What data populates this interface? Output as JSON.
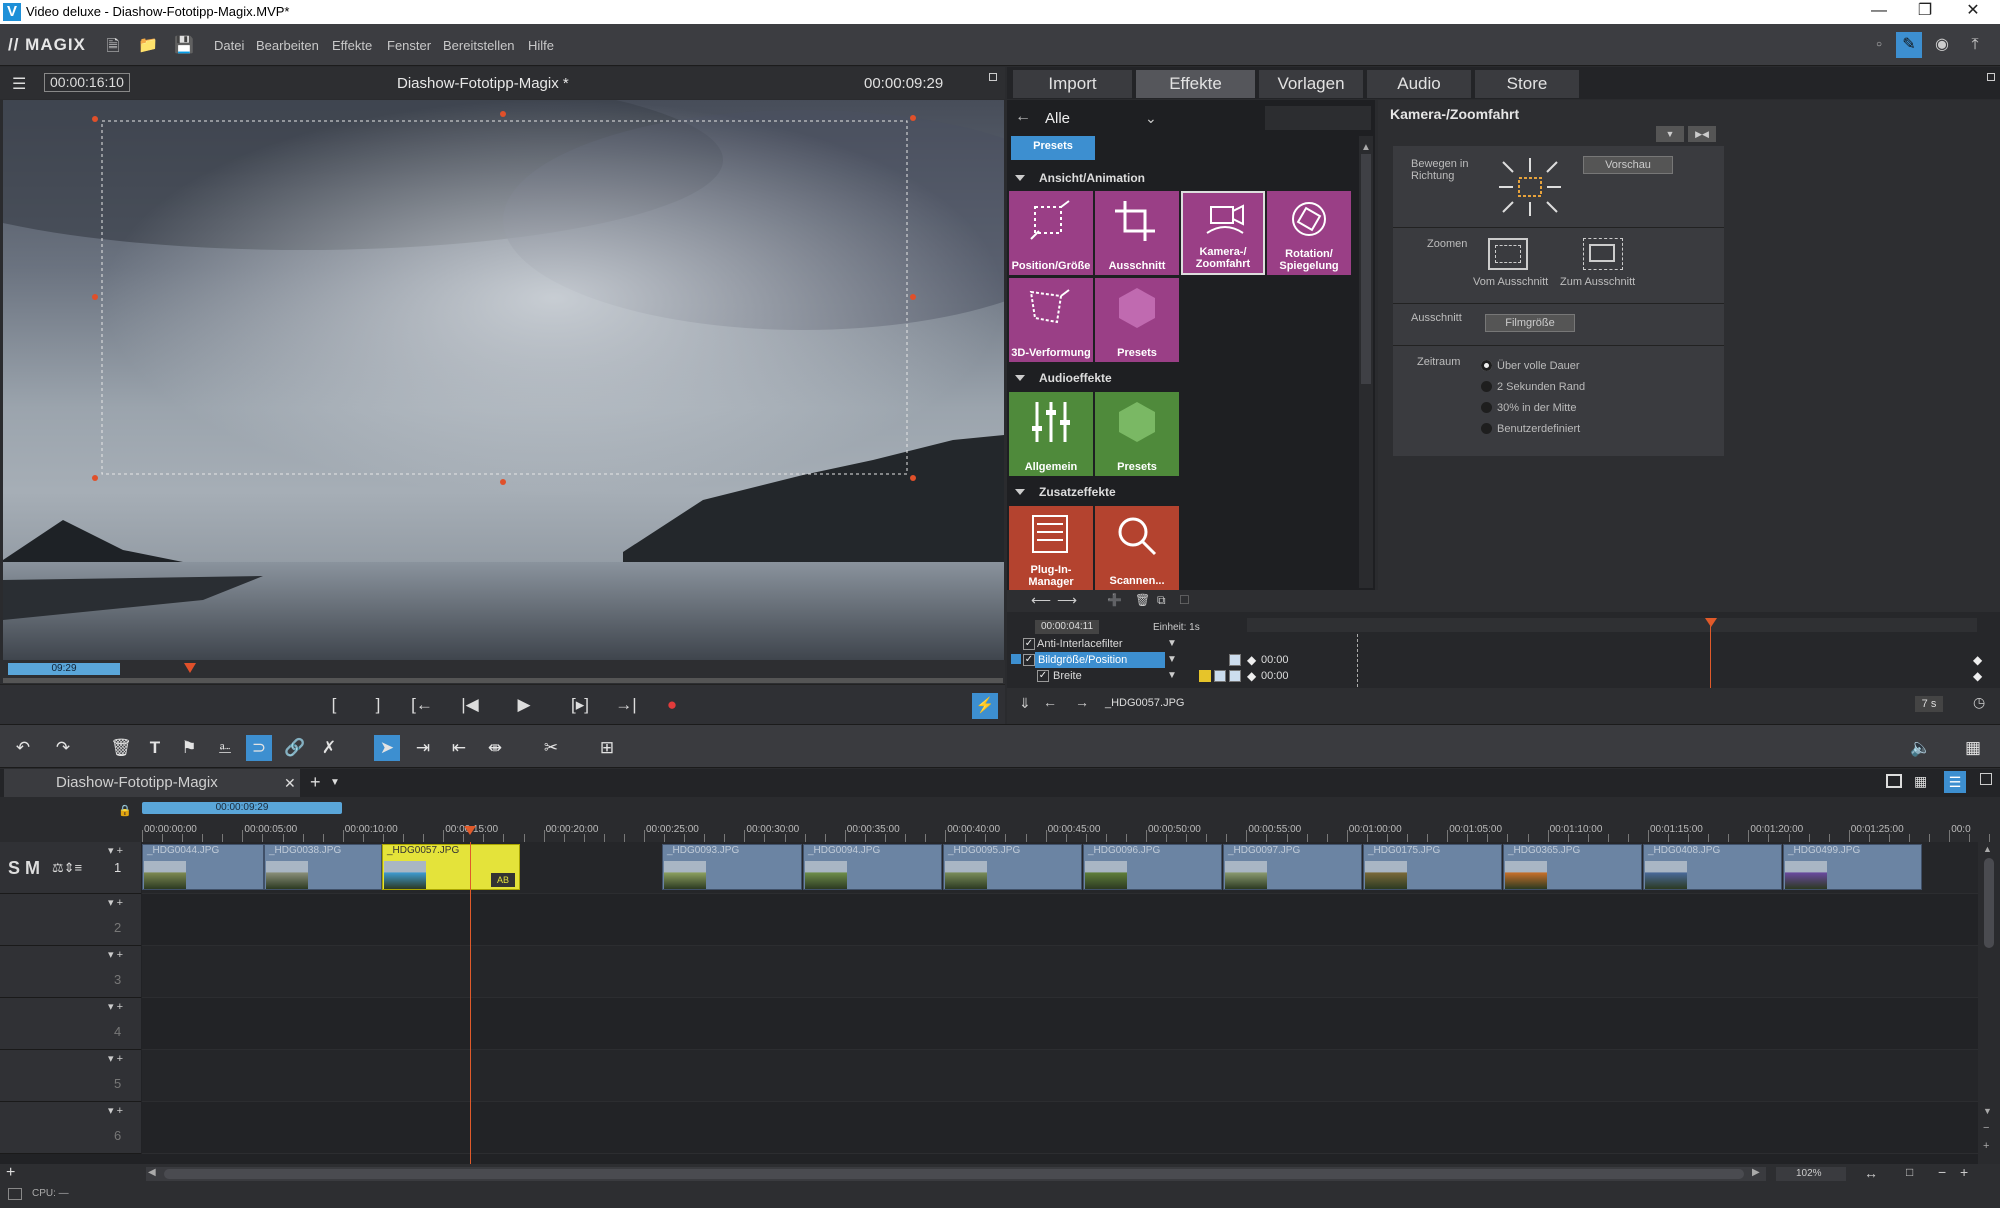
{
  "window": {
    "title": "Video deluxe - Diashow-Fototipp-Magix.MVP*",
    "app_icon": "V",
    "controls": [
      "minimize-icon",
      "maximize-icon",
      "close-icon"
    ]
  },
  "menubar": {
    "brand": "// MAGIX",
    "items": [
      "Datei",
      "Bearbeiten",
      "Effekte",
      "Fenster",
      "Bereitstellen",
      "Hilfe"
    ]
  },
  "preview": {
    "position_time": "00:00:16:10",
    "project_name": "Diashow-Fototipp-Magix *",
    "duration_time": "00:00:09:29",
    "scrub_label": "09:29"
  },
  "transport": {
    "buttons": [
      "[",
      "]",
      "[←",
      "|◀",
      "▶",
      "[▸]",
      "→|",
      "●"
    ]
  },
  "tabs": {
    "items": [
      "Import",
      "Effekte",
      "Vorlagen",
      "Audio",
      "Store"
    ],
    "active": "Effekte"
  },
  "effects": {
    "filter_label": "Alle",
    "presets_btn": "Presets",
    "sections": [
      {
        "title": "Ansicht/Animation",
        "tiles": [
          "Position/Größe",
          "Ausschnitt",
          "Kamera-/ Zoomfahrt",
          "Rotation/ Spiegelung",
          "3D-Verformung",
          "Presets"
        ]
      },
      {
        "title": "Audioeffekte",
        "tiles": [
          "Allgemein",
          "Presets"
        ]
      },
      {
        "title": "Zusatzeffekte",
        "tiles": [
          "Plug-In-Manager",
          "Scannen..."
        ]
      }
    ]
  },
  "kamera": {
    "title": "Kamera-/Zoomfahrt",
    "bewegen_label": "Bewegen in Richtung",
    "vorschau_btn": "Vorschau",
    "zoomen_label": "Zoomen",
    "vom_ausschnitt": "Vom Ausschnitt",
    "zum_ausschnitt": "Zum Ausschnitt",
    "ausschnitt_label": "Ausschnitt",
    "filmgroesse_btn": "Filmgröße",
    "zeitraum_label": "Zeitraum",
    "zeitraum_options": [
      "Über volle Dauer",
      "2 Sekunden Rand",
      "30% in der Mitte",
      "Benutzerdefiniert"
    ],
    "zeitraum_selected": "Über volle Dauer"
  },
  "keyframes": {
    "time": "00:00:04:11",
    "unit_label": "Einheit: 1s",
    "rows": [
      {
        "name": "Anti-Interlacefilter",
        "value": ""
      },
      {
        "name": "Bildgröße/Position",
        "value": "00:00"
      },
      {
        "name": "Breite",
        "value": "00:00"
      }
    ],
    "clip_name": "_HDG0057.JPG",
    "zoom_value": "7 s"
  },
  "project": {
    "tab_name": "Diashow-Fototipp-Magix",
    "range_label": "00:00:09:29",
    "ruler_ticks": [
      "00:00:00:00",
      "00:00:05:00",
      "00:00:10:00",
      "00:00:15:00",
      "00:00:20:00",
      "00:00:25:00",
      "00:00:30:00",
      "00:00:35:00",
      "00:00:40:00",
      "00:00:45:00",
      "00:00:50:00",
      "00:00:55:00",
      "00:01:00:00",
      "00:01:05:00",
      "00:01:10:00",
      "00:01:15:00",
      "00:01:20:00",
      "00:01:25:00",
      "00:0"
    ],
    "track_numbers": [
      "1",
      "2",
      "3",
      "4",
      "5",
      "6"
    ],
    "track1_controls": "S M",
    "clips": [
      "_HDG0044.JPG",
      "_HDG0038.JPG",
      "_HDG0057.JPG",
      "_HDG0093.JPG",
      "_HDG0094.JPG",
      "_HDG0095.JPG",
      "_HDG0096.JPG",
      "_HDG0097.JPG",
      "_HDG0175.JPG",
      "_HDG0365.JPG",
      "_HDG0408.JPG",
      "_HDG0499.JPG"
    ],
    "zoom_percent": "102%"
  },
  "status": {
    "cpu": "CPU: —"
  },
  "colors": {
    "accent": "#3d8fd0",
    "magenta_tile": "#9a3f86",
    "green_tile": "#4f8a3b",
    "red_tile": "#b4432f",
    "selected_clip": "#e4e33a",
    "playhead": "#e05a2a"
  }
}
